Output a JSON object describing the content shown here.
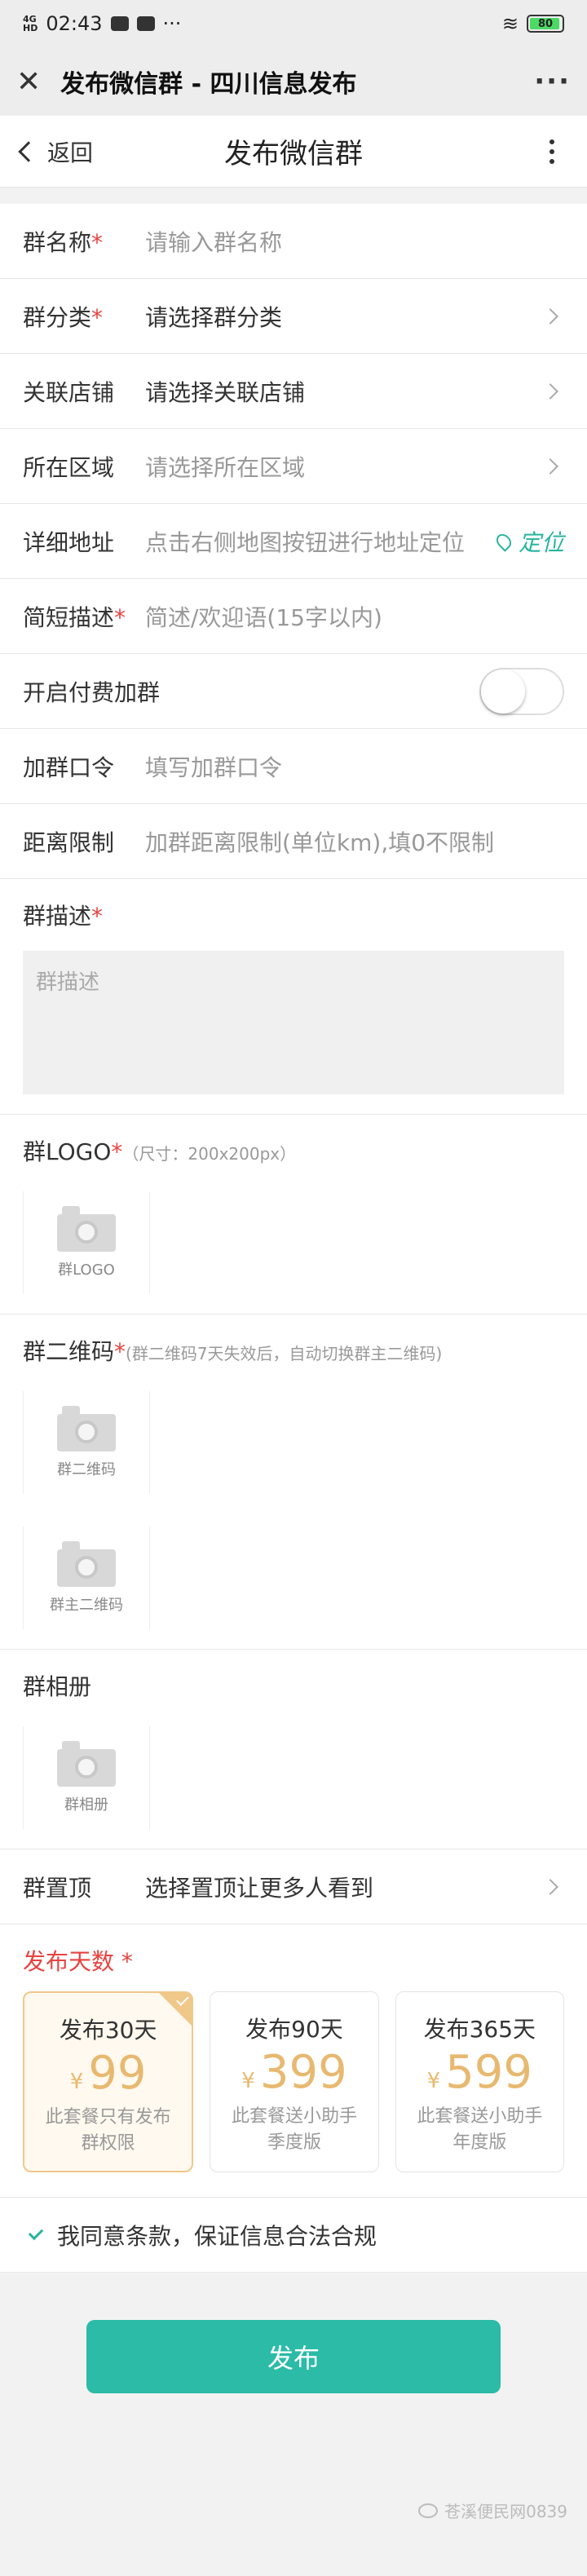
{
  "status_bar": {
    "time": "02:43",
    "network_top": "4G",
    "network_bottom": "HD",
    "battery": "80",
    "more": "···"
  },
  "wechat_bar": {
    "title": "发布微信群 - 四川信息发布",
    "more": "···"
  },
  "navbar": {
    "back_label": "返回",
    "title": "发布微信群"
  },
  "form": {
    "group_name": {
      "label": "群名称",
      "required": "*",
      "placeholder": "请输入群名称"
    },
    "group_category": {
      "label": "群分类",
      "required": "*",
      "value": "请选择群分类"
    },
    "linked_store": {
      "label": "关联店铺",
      "value": "请选择关联店铺"
    },
    "region": {
      "label": "所在区域",
      "placeholder": "请选择所在区域"
    },
    "address": {
      "label": "详细地址",
      "placeholder": "点击右侧地图按钮进行地址定位",
      "locate_label": "定位"
    },
    "short_desc": {
      "label": "简短描述",
      "required": "*",
      "placeholder": "简述/欢迎语(15字以内)"
    },
    "paid_join": {
      "label": "开启付费加群",
      "enabled": false
    },
    "join_password": {
      "label": "加群口令",
      "placeholder": "填写加群口令"
    },
    "distance_limit": {
      "label": "距离限制",
      "placeholder": "加群距离限制(单位km),填0不限制"
    },
    "group_desc": {
      "label": "群描述",
      "required": "*",
      "placeholder": "群描述"
    },
    "group_logo": {
      "label": "群LOGO",
      "required": "*",
      "note": "（尺寸：200x200px）",
      "upload_label": "群LOGO"
    },
    "group_qr": {
      "label": "群二维码",
      "required": "*",
      "note": "(群二维码7天失效后，自动切换群主二维码)",
      "upload_label": "群二维码",
      "owner_upload_label": "群主二维码"
    },
    "group_album": {
      "label": "群相册",
      "upload_label": "群相册"
    },
    "group_top": {
      "label": "群置顶",
      "value": "选择置顶让更多人看到"
    }
  },
  "publish_days": {
    "label": "发布天数",
    "required": "*",
    "plans": [
      {
        "name": "发布30天",
        "currency": "¥",
        "price": "99",
        "desc": "此套餐只有发布群权限",
        "selected": true
      },
      {
        "name": "发布90天",
        "currency": "¥",
        "price": "399",
        "desc": "此套餐送小助手季度版",
        "selected": false
      },
      {
        "name": "发布365天",
        "currency": "¥",
        "price": "599",
        "desc": "此套餐送小助手 年度版",
        "selected": false
      }
    ]
  },
  "agreement": {
    "text": "我同意条款，保证信息合法合规",
    "checked": true
  },
  "publish_button": "发布",
  "watermark": "苍溪便民网0839",
  "colors": {
    "accent": "#2bbba7",
    "required": "#e64340",
    "price": "#e7b970"
  }
}
